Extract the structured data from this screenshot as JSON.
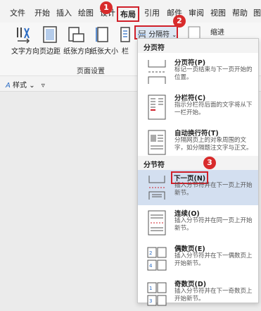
{
  "menubar": {
    "items": [
      "文件",
      "开始",
      "插入",
      "绘图",
      "设计",
      "布局",
      "引用",
      "邮件",
      "审阅",
      "视图",
      "帮助",
      "图"
    ]
  },
  "markers": [
    "1",
    "2",
    "3"
  ],
  "ribbon": {
    "buttons": [
      "文字方向",
      "页边距",
      "纸张方向",
      "纸张大小",
      "栏"
    ],
    "group_label": "页面设置",
    "breaks_label": "分隔符",
    "indent_label": "缩进"
  },
  "stylebar": {
    "label": "样式"
  },
  "dropdown": {
    "page_breaks_header": "分页符",
    "section_breaks_header": "分节符",
    "options": [
      {
        "title": "分页符(P)",
        "desc": "标记一页结束与下一页开始的位置。",
        "icon": "page-break-icon"
      },
      {
        "title": "分栏符(C)",
        "desc": "指示分栏符后面的文字将从下一栏开始。",
        "icon": "column-break-icon"
      },
      {
        "title": "自动换行符(T)",
        "desc": "分隔网页上的对象周围的文字，如分隔题注文字与正文。",
        "icon": "text-wrapping-icon"
      },
      {
        "title": "下一页(N)",
        "desc": "插入分节符并在下一页上开始新节。",
        "icon": "next-page-icon"
      },
      {
        "title": "连续(O)",
        "desc": "插入分节符并在同一页上开始新节。",
        "icon": "continuous-icon"
      },
      {
        "title": "偶数页(E)",
        "desc": "插入分节符并在下一偶数页上开始新节。",
        "icon": "even-page-icon"
      },
      {
        "title": "奇数页(D)",
        "desc": "插入分节符并在下一奇数页上开始新节。",
        "icon": "odd-page-icon"
      }
    ]
  },
  "colors": {
    "accent_red": "#d0202a",
    "selected_bg": "#d3dff0"
  }
}
